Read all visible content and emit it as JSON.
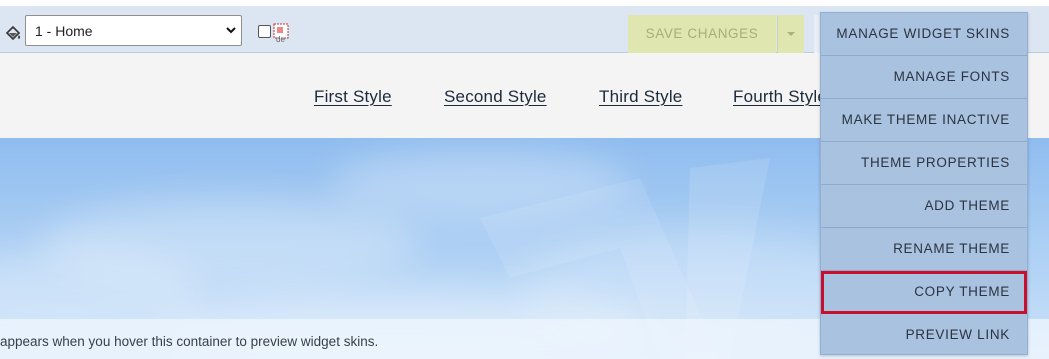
{
  "toolbar": {
    "page_select_value": "1 - Home",
    "save_label": "SAVE CHANGES"
  },
  "nav": {
    "links": [
      "First Style",
      "Second Style",
      "Third Style",
      "Fourth Style"
    ]
  },
  "hero": {
    "caption": "appears when you hover this container to preview widget skins."
  },
  "menu": {
    "items": [
      "MANAGE WIDGET SKINS",
      "MANAGE FONTS",
      "MAKE THEME INACTIVE",
      "THEME PROPERTIES",
      "ADD THEME",
      "RENAME THEME",
      "COPY THEME",
      "PREVIEW LINK"
    ],
    "highlight_color": "#c8102e"
  },
  "icons": {
    "toolbar": [
      "paint-bucket-icon",
      "chevron-down-icon",
      "broken-image-icon",
      "caret-down-icon"
    ]
  }
}
